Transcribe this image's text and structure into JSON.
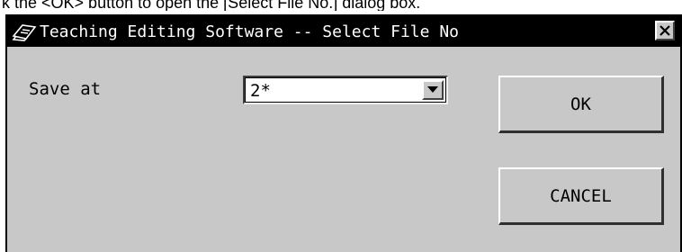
{
  "caption": "k the <OK> button to open the [Select File No.] dialog box.",
  "dialog": {
    "title": "Teaching Editing Software -- Select File No",
    "close_label": "×",
    "save_at_label": "Save at",
    "file_no": {
      "selected": "2*"
    },
    "ok_label": "OK",
    "cancel_label": "CANCEL"
  },
  "icons": {
    "app": "teaching-pendant-icon",
    "close": "close-icon",
    "dropdown": "dropdown-arrow-icon"
  },
  "colors": {
    "titlebar": "#000000",
    "face": "#c8c8c8",
    "field": "#ffffff"
  }
}
